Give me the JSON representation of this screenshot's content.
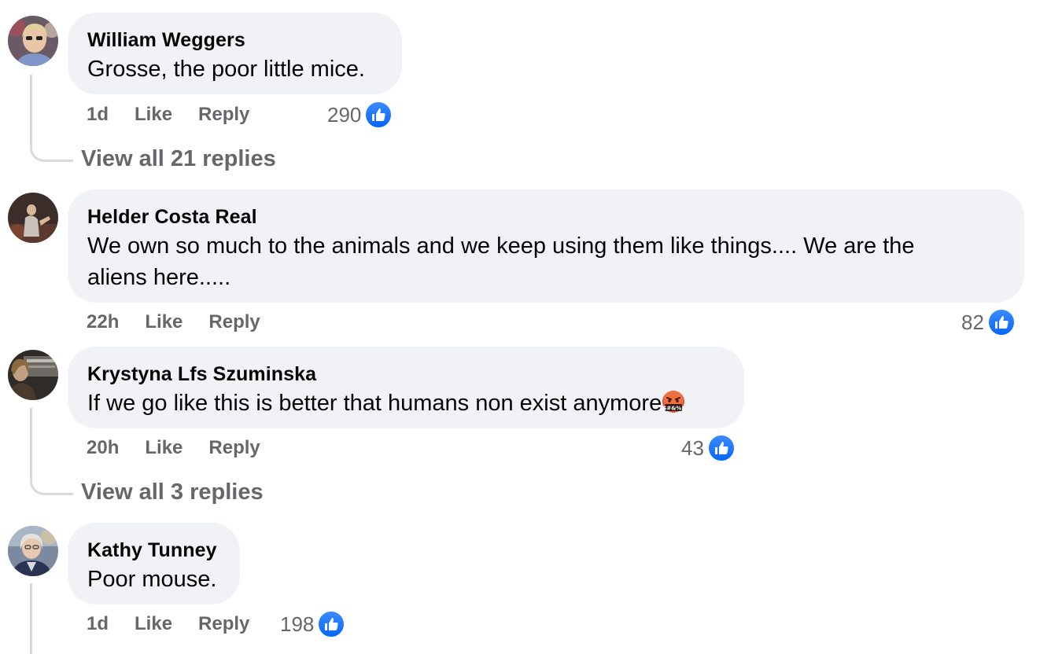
{
  "comments": [
    {
      "author": "William Weggers",
      "text": "Grosse, the poor little mice.",
      "time": "1d",
      "like_label": "Like",
      "reply_label": "Reply",
      "reaction_count": "290",
      "view_replies": "View all 21 replies"
    },
    {
      "author": "Helder Costa Real",
      "text_line1": "We own so much to the animals and we keep using them like things.... We are the",
      "text_line2": "aliens here.....",
      "time": "22h",
      "like_label": "Like",
      "reply_label": "Reply",
      "reaction_count": "82"
    },
    {
      "author": "Krystyna Lfs Szuminska",
      "text": "If we go like this is better that humans non exist anymore",
      "emoji": "face-with-symbols-on-mouth",
      "time": "20h",
      "like_label": "Like",
      "reply_label": "Reply",
      "reaction_count": "43",
      "view_replies": "View all 3 replies"
    },
    {
      "author": "Kathy Tunney",
      "text": "Poor mouse.",
      "time": "1d",
      "like_label": "Like",
      "reply_label": "Reply",
      "reaction_count": "198"
    }
  ],
  "icons": {
    "reaction": "thumbs-up-icon",
    "reaction_color": "#0866ff"
  },
  "colors": {
    "bubble_bg": "#f0f2f5",
    "secondary_text": "#65676b",
    "primary_text": "#050505"
  }
}
